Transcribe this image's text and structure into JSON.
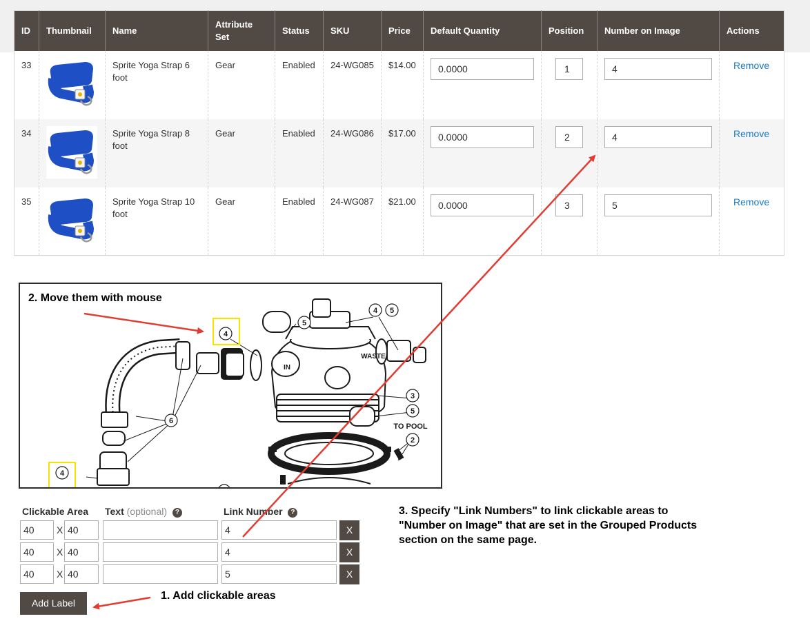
{
  "table": {
    "columns": [
      "ID",
      "Thumbnail",
      "Name",
      "Attribute Set",
      "Status",
      "SKU",
      "Price",
      "Default Quantity",
      "Position",
      "Number on Image",
      "Actions"
    ],
    "rows": [
      {
        "id": "33",
        "thumbnail": "yoga-strap-image",
        "name": "Sprite Yoga Strap 6 foot",
        "attribute_set": "Gear",
        "status": "Enabled",
        "sku": "24-WG085",
        "price": "$14.00",
        "default_quantity": "0.0000",
        "position": "1",
        "number_on_image": "4",
        "action": "Remove"
      },
      {
        "id": "34",
        "thumbnail": "yoga-strap-image",
        "name": "Sprite Yoga Strap 8 foot",
        "attribute_set": "Gear",
        "status": "Enabled",
        "sku": "24-WG086",
        "price": "$17.00",
        "default_quantity": "0.0000",
        "position": "2",
        "number_on_image": "4",
        "action": "Remove"
      },
      {
        "id": "35",
        "thumbnail": "yoga-strap-image",
        "name": "Sprite Yoga Strap 10 foot",
        "attribute_set": "Gear",
        "status": "Enabled",
        "sku": "24-WG087",
        "price": "$21.00",
        "default_quantity": "0.0000",
        "position": "3",
        "number_on_image": "5",
        "action": "Remove"
      }
    ]
  },
  "image_panel": {
    "caption": "2. Move them with mouse",
    "labels": {
      "in": "IN",
      "waste": "WASTE",
      "to_pool": "TO POOL",
      "callout_4": "4",
      "callout_5": "5",
      "callout_3": "3",
      "callout_2": "2",
      "callout_6": "6"
    }
  },
  "label_editor": {
    "headers": {
      "clickable_area": "Clickable Area",
      "text": "Text",
      "text_optional": "(optional)",
      "link_number": "Link Number"
    },
    "help_glyph": "?",
    "times": "X",
    "delete_label": "X",
    "rows": [
      {
        "width": "40",
        "height": "40",
        "text": "",
        "link_number": "4"
      },
      {
        "width": "40",
        "height": "40",
        "text": "",
        "link_number": "4"
      },
      {
        "width": "40",
        "height": "40",
        "text": "",
        "link_number": "5"
      }
    ],
    "add_button": "Add Label"
  },
  "annotations": {
    "step1": "1. Add clickable areas",
    "step3_line1": "3. Specify \"Link Numbers\" to link clickable areas to",
    "step3_line2": "\"Number on Image\" that are set in the Grouped Products",
    "step3_line3": "section on the same page."
  },
  "colors": {
    "header_bg": "#514943",
    "link": "#1979c3",
    "arrow": "#e03c31",
    "highlight_box": "#f2e600",
    "strap": "#1f4fc4"
  }
}
